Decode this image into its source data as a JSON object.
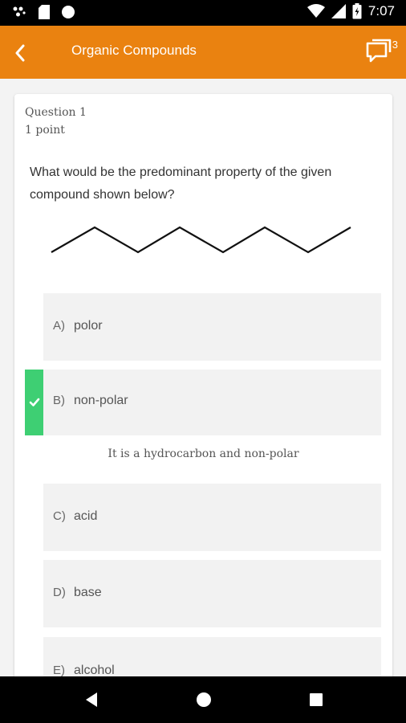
{
  "status_bar": {
    "time": "7:07",
    "icons": [
      "notification-dots-icon",
      "sd-card-icon",
      "circle-icon",
      "wifi-icon",
      "signal-icon",
      "battery-icon"
    ]
  },
  "app_bar": {
    "title": "Organic Compounds",
    "comment_count": "3",
    "color": "#ea8210"
  },
  "question": {
    "number_label": "Question 1",
    "points_label": "1 point",
    "text": "What would be the predominant property of the given compound shown below?"
  },
  "options": [
    {
      "letter": "A)",
      "text": "polor"
    },
    {
      "letter": "B)",
      "text": "non-polar",
      "correct": true
    },
    {
      "letter": "C)",
      "text": "acid"
    },
    {
      "letter": "D)",
      "text": "base"
    },
    {
      "letter": "E)",
      "text": "alcohol"
    }
  ],
  "explanation": "It is a hydrocarbon and non-polar",
  "colors": {
    "correct": "#3ecf73",
    "option_bg": "#f2f2f2"
  }
}
